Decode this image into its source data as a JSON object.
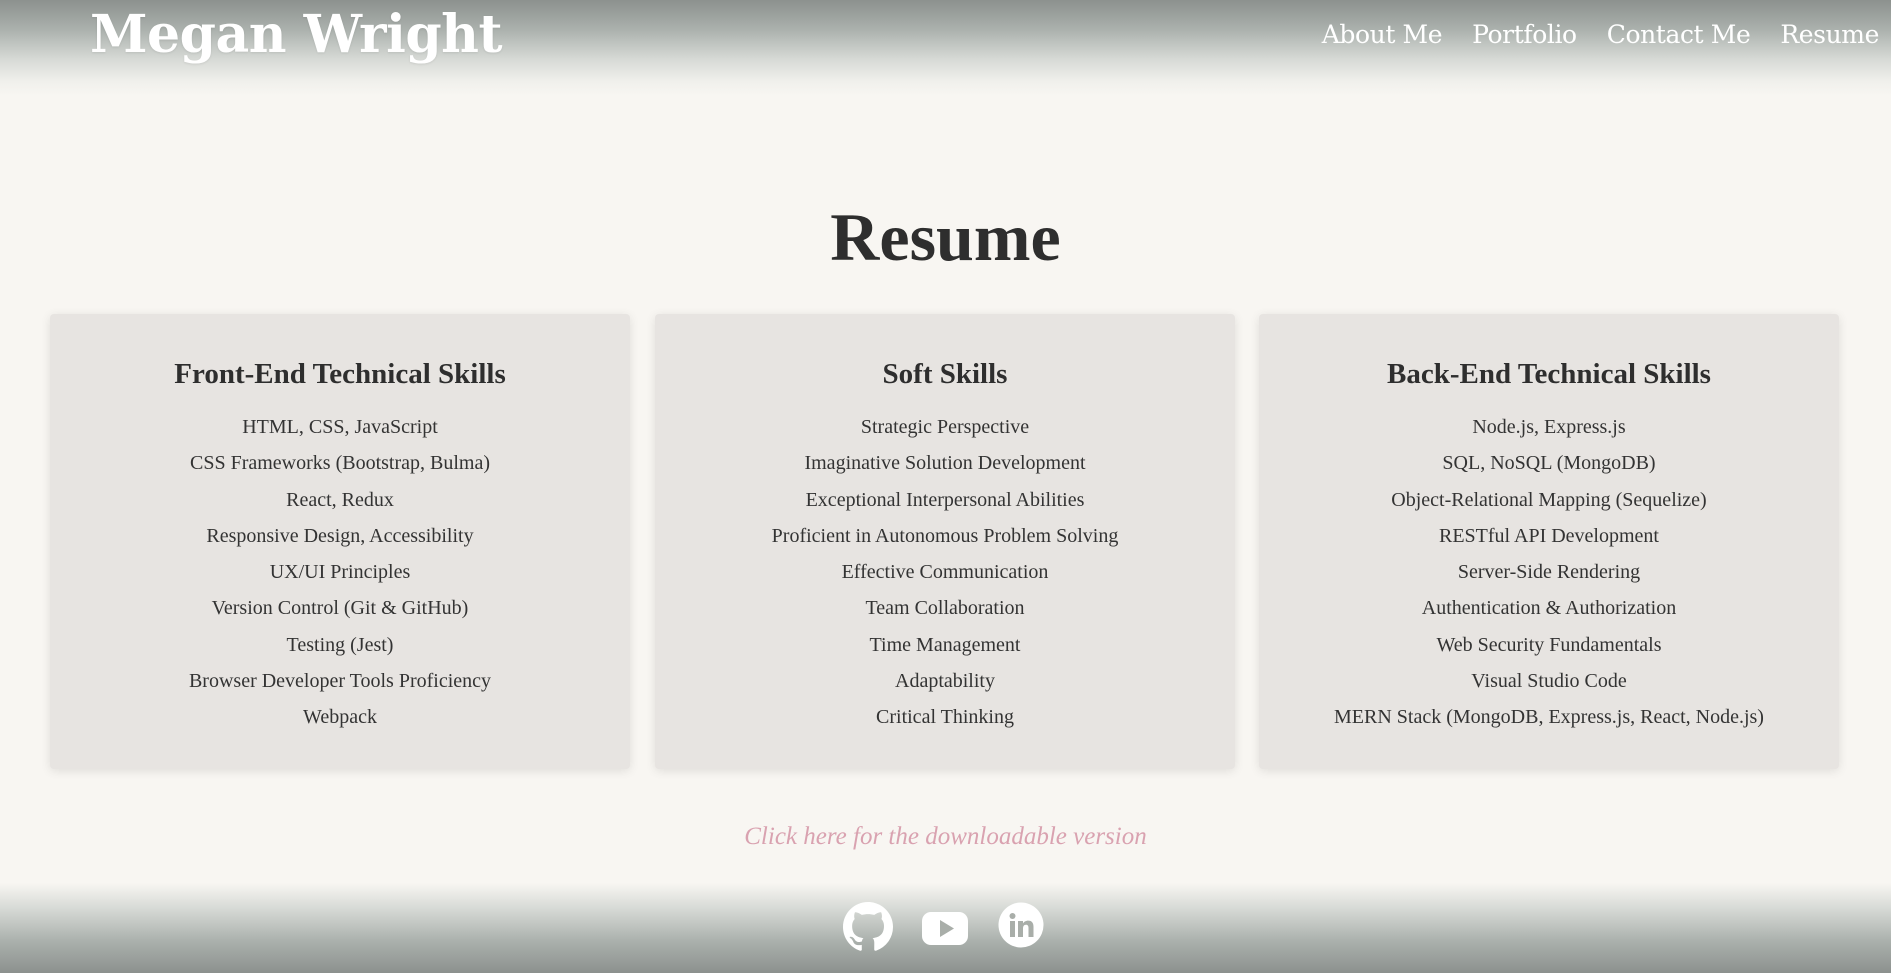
{
  "header": {
    "brand": "Megan Wright",
    "nav": [
      "About Me",
      "Portfolio",
      "Contact Me",
      "Resume"
    ]
  },
  "main": {
    "title": "Resume",
    "cards": [
      {
        "title": "Front-End Technical Skills",
        "items": [
          "HTML, CSS, JavaScript",
          "CSS Frameworks (Bootstrap, Bulma)",
          "React, Redux",
          "Responsive Design, Accessibility",
          "UX/UI Principles",
          "Version Control (Git & GitHub)",
          "Testing (Jest)",
          "Browser Developer Tools Proficiency",
          "Webpack"
        ]
      },
      {
        "title": "Soft Skills",
        "items": [
          "Strategic Perspective",
          "Imaginative Solution Development",
          "Exceptional Interpersonal Abilities",
          "Proficient in Autonomous Problem Solving",
          "Effective Communication",
          "Team Collaboration",
          "Time Management",
          "Adaptability",
          "Critical Thinking"
        ]
      },
      {
        "title": "Back-End Technical Skills",
        "items": [
          "Node.js, Express.js",
          "SQL, NoSQL (MongoDB)",
          "Object-Relational Mapping (Sequelize)",
          "RESTful API Development",
          "Server-Side Rendering",
          "Authentication & Authorization",
          "Web Security Fundamentals",
          "Visual Studio Code",
          "MERN Stack (MongoDB, Express.js, React, Node.js)"
        ]
      }
    ],
    "download_link": "Click here for the downloadable version"
  },
  "footer": {
    "social_icons": [
      "github-icon",
      "youtube-icon",
      "linkedin-icon"
    ]
  },
  "colors": {
    "background": "#f8f6f2",
    "card": "#e7e4e1",
    "header_gradient": "#8c918e",
    "link_pink": "#d9a2b0",
    "text": "#2e2e2e"
  }
}
